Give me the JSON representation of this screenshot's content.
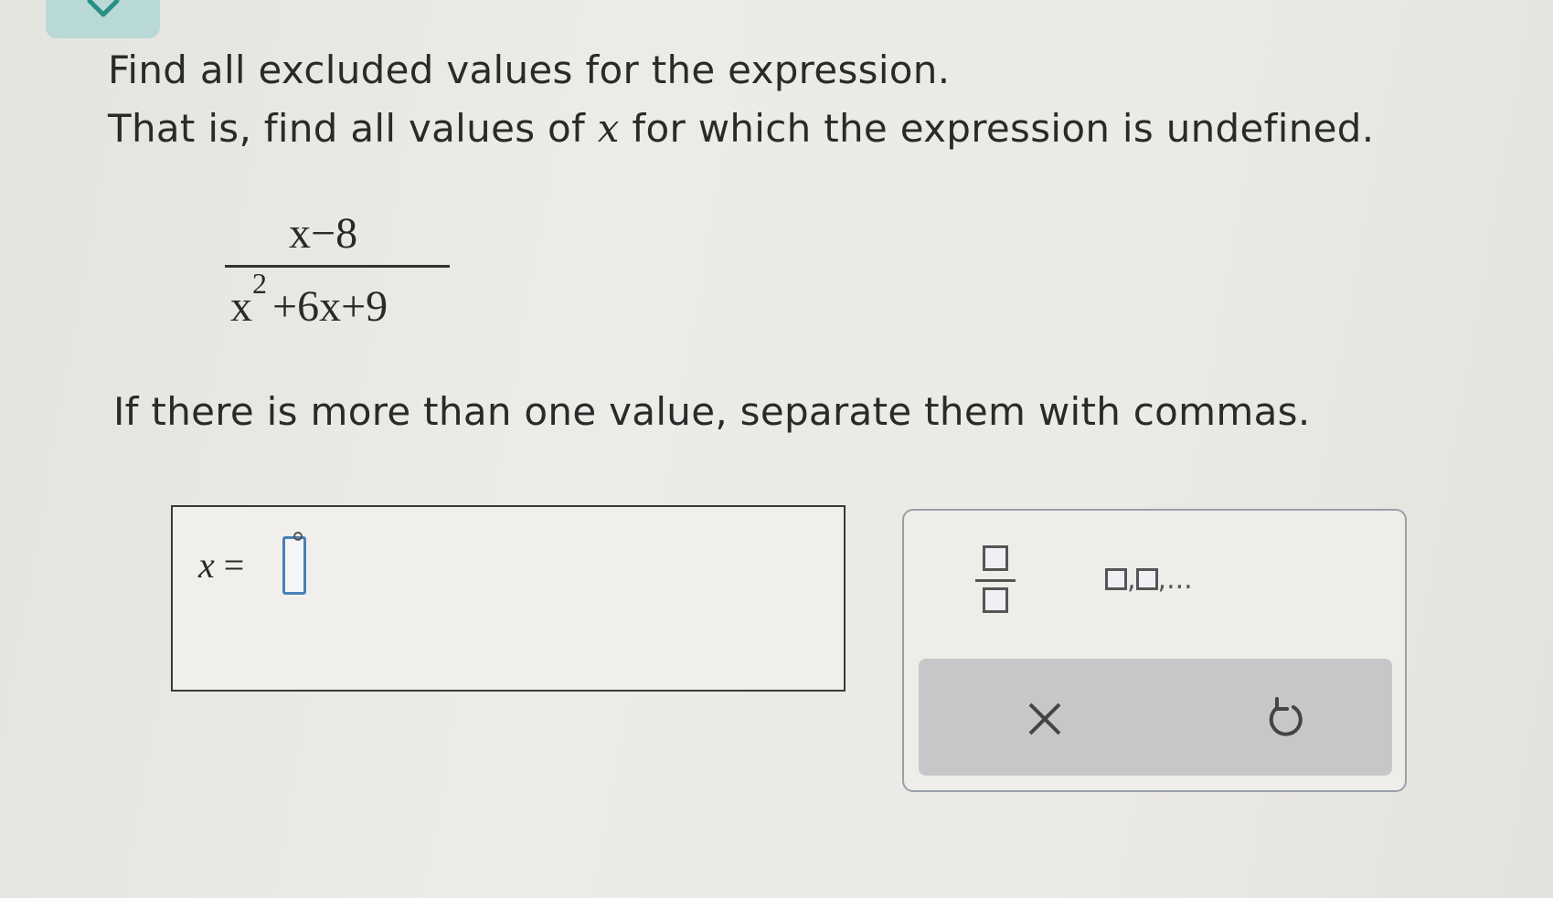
{
  "prompt": {
    "line1": "Find all excluded values for the expression.",
    "line2_before": "That is, find all values of ",
    "line2_var": "x",
    "line2_after": " for which the expression is undefined.",
    "instruction": "If there is more than one value, separate them with commas."
  },
  "expression": {
    "numerator": "x−8",
    "denominator_base": "x",
    "denominator_exp": "2",
    "denominator_rest": "+6x+9"
  },
  "answer": {
    "variable": "x",
    "equals": "=",
    "value": ""
  },
  "tools": {
    "list_label": ",",
    "list_ellipsis": ",...",
    "clear_symbol": "×"
  },
  "colors": {
    "tab": "#b8d9d5",
    "tab_check": "#2a8f86",
    "cursor": "#4b7fb8",
    "action_bar": "#c6c7c9"
  }
}
